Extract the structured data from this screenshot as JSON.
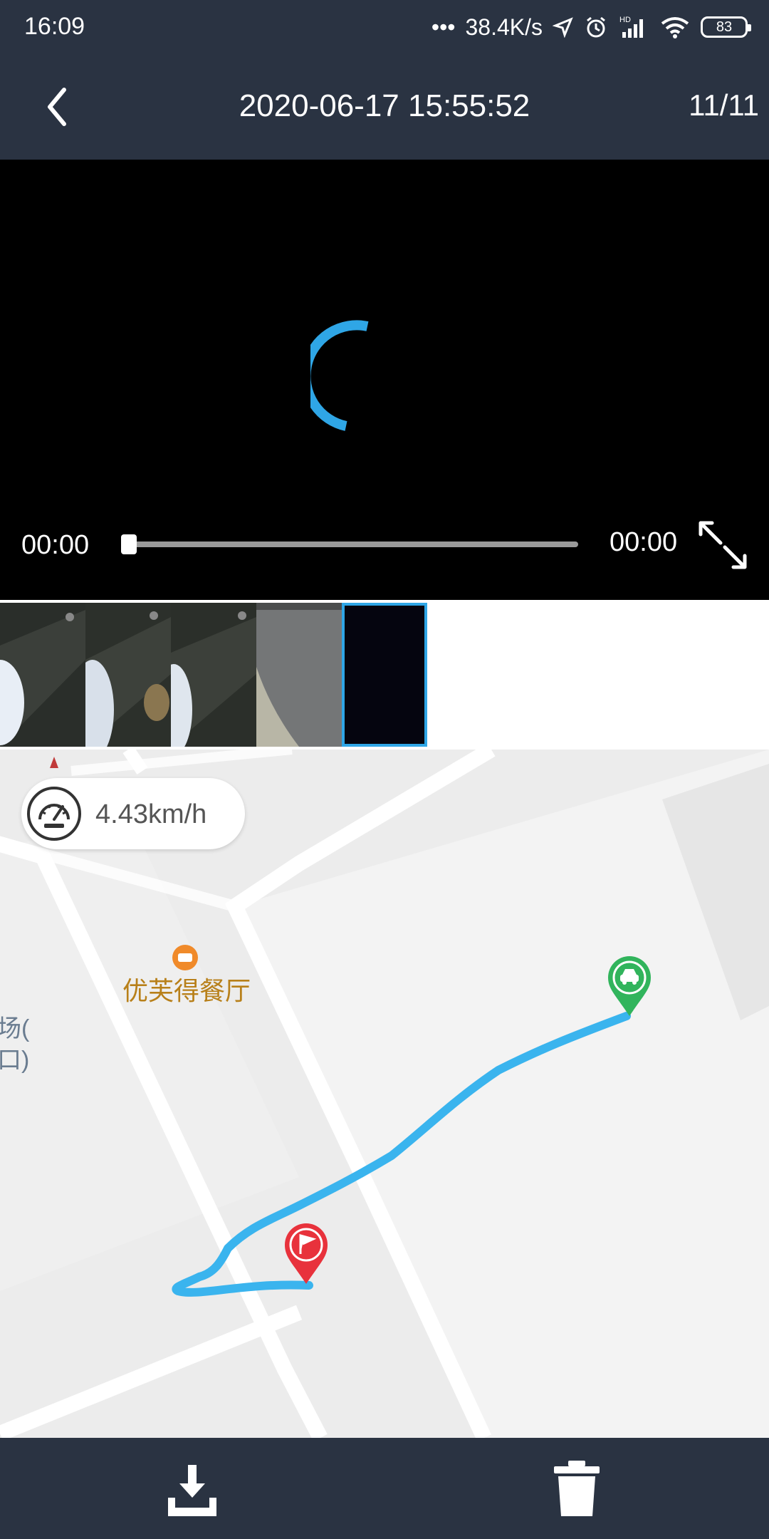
{
  "status_bar": {
    "time": "16:09",
    "network_speed": "38.4K/s",
    "battery_level": "83"
  },
  "header": {
    "title": "2020-06-17 15:55:52",
    "counter": "11/11"
  },
  "player": {
    "current_time": "00:00",
    "duration": "00:00",
    "progress": 0
  },
  "thumbnails": {
    "count": 5,
    "selected_index": 4
  },
  "map": {
    "speed": "4.43km/h",
    "poi_label": "优芙得餐厅",
    "edge_label_line1": "场(",
    "edge_label_line2": "口)",
    "route_color": "#3ab4ee",
    "start_marker_color": "#e8323c",
    "end_marker_color": "#31b45c"
  },
  "colors": {
    "bar_bg": "#2a3342",
    "accent": "#2fa6e6"
  }
}
